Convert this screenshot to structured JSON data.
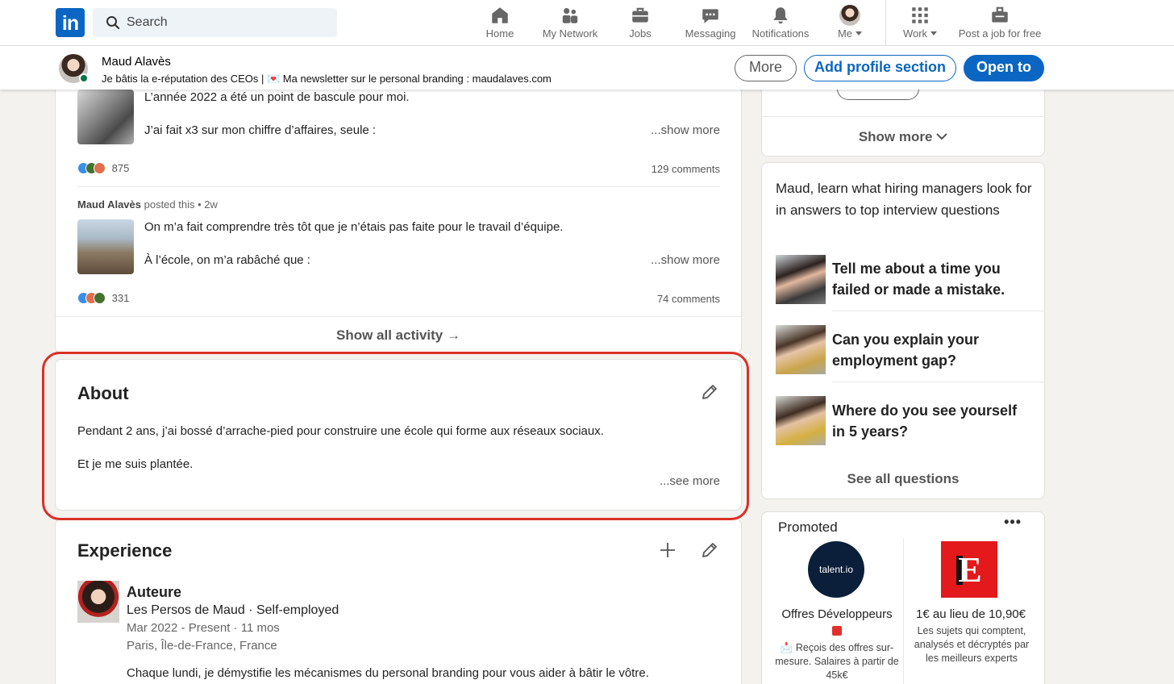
{
  "nav": {
    "search_placeholder": "Search",
    "items": [
      {
        "label": "Home",
        "icon": "home-icon"
      },
      {
        "label": "My Network",
        "icon": "network-icon"
      },
      {
        "label": "Jobs",
        "icon": "briefcase-icon"
      },
      {
        "label": "Messaging",
        "icon": "messaging-icon"
      },
      {
        "label": "Notifications",
        "icon": "bell-icon"
      },
      {
        "label": "Me",
        "icon": "avatar"
      },
      {
        "label": "Work",
        "icon": "grid-icon"
      },
      {
        "label": "Post a job for free",
        "icon": "job-post-icon"
      }
    ]
  },
  "profile_bar": {
    "name": "Maud Alavès",
    "headline": "Je bâtis la e-réputation des CEOs | 💌 Ma newsletter sur le personal branding : maudalaves.com",
    "more_label": "More",
    "add_section_label": "Add profile section",
    "open_to_label": "Open to"
  },
  "activity": {
    "posts": [
      {
        "line1": "L’année 2022 a été un point de bascule pour moi.",
        "line2": "J’ai fait x3 sur mon chiffre d’affaires, seule :",
        "show_more": "...show more",
        "reaction_count": "875",
        "comments": "129 comments"
      },
      {
        "author": "Maud Alavès",
        "posted_suffix": " posted this • 2w",
        "line1": "On m’a fait comprendre très tôt que je n’étais pas faite pour le travail d’équipe.",
        "line2": "À l’école, on m’a rabâché que :",
        "show_more": "...show more",
        "reaction_count": "331",
        "comments": "74 comments"
      }
    ],
    "show_all": "Show all activity →"
  },
  "about": {
    "title": "About",
    "line1": "Pendant 2 ans, j’ai bossé d’arrache-pied pour construire une école qui forme aux réseaux sociaux.",
    "line2": "Et je me suis plantée.",
    "see_more": "...see more"
  },
  "experience": {
    "title": "Experience",
    "role": "Auteure",
    "company": "Les Persos de Maud · Self-employed",
    "dates": "Mar 2022 - Present · 11 mos",
    "location": "Paris, Île-de-France, France",
    "description": "Chaque lundi, je démystifie les mécanismes du personal branding pour vous aider à bâtir le vôtre."
  },
  "rail": {
    "show_more": "Show more",
    "interview_heading": "Maud, learn what hiring managers look for in answers to top interview questions",
    "questions": [
      "Tell me about a time you failed or made a mistake.",
      "Can you explain your employment gap?",
      "Where do you see yourself in 5 years?"
    ],
    "see_all": "See all questions"
  },
  "promoted": {
    "label": "Promoted",
    "dots": "•••",
    "ads": [
      {
        "logo_text": "talent.io",
        "title": "Offres Développeurs",
        "subtitle": "📩 Reçois des offres sur-mesure. Salaires à partir de 45k€"
      },
      {
        "logo_text": "E",
        "title": "1€ au lieu de 10,90€",
        "subtitle": "Les sujets qui comptent, analysés et décryptés par les meilleurs experts"
      }
    ]
  },
  "colors": {
    "brand_blue": "#0a66c2",
    "highlight_red": "#d93025",
    "online_green": "#057642"
  }
}
